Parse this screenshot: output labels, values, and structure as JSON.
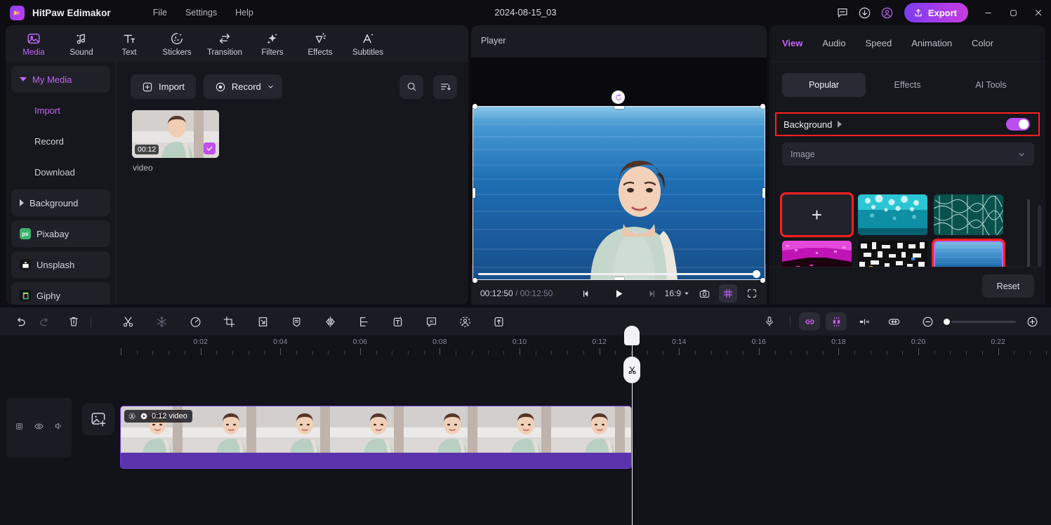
{
  "titlebar": {
    "app_name": "HitPaw Edimakor",
    "menus": [
      {
        "label": "File",
        "name": "menu-file"
      },
      {
        "label": "Settings",
        "name": "menu-settings"
      },
      {
        "label": "Help",
        "name": "menu-help"
      }
    ],
    "project_title": "2024-08-15_03",
    "icons": [
      "feedback-icon",
      "download-icon",
      "account-icon"
    ],
    "export_label": "Export",
    "window_controls": [
      "minimize-icon",
      "maximize-icon",
      "close-icon"
    ]
  },
  "tools": [
    {
      "label": "Media",
      "icon": "media-icon",
      "active": true
    },
    {
      "label": "Sound",
      "icon": "sound-icon",
      "active": false
    },
    {
      "label": "Text",
      "icon": "text-icon",
      "active": false
    },
    {
      "label": "Stickers",
      "icon": "stickers-icon",
      "active": false
    },
    {
      "label": "Transition",
      "icon": "transition-icon",
      "active": false
    },
    {
      "label": "Filters",
      "icon": "filters-icon",
      "active": false
    },
    {
      "label": "Effects",
      "icon": "effects-icon",
      "active": false
    },
    {
      "label": "Subtitles",
      "icon": "subtitles-icon",
      "active": false
    }
  ],
  "sidebar": {
    "my_media": "My Media",
    "sub_items": [
      "Import",
      "Record",
      "Download"
    ],
    "background": "Background",
    "pixabay": "Pixabay",
    "pixabay_badge": "px",
    "unsplash": "Unsplash",
    "giphy": "Giphy"
  },
  "media": {
    "import_label": "Import",
    "record_label": "Record",
    "search_icon": "search-icon",
    "sort_icon": "sort-icon",
    "items": [
      {
        "name": "video",
        "duration": "00:12",
        "selected": true
      }
    ]
  },
  "player": {
    "title": "Player",
    "current_time": "00:12:50",
    "total_time": "00:12:50",
    "separator": "/",
    "aspect_ratio": "16:9",
    "controls": [
      "prev-frame-icon",
      "play-icon",
      "next-frame-icon"
    ],
    "right_icons": [
      "snapshot-icon",
      "grid-icon",
      "fullscreen-icon"
    ]
  },
  "right_panel": {
    "tabs": [
      {
        "label": "View",
        "active": true
      },
      {
        "label": "Audio",
        "active": false
      },
      {
        "label": "Speed",
        "active": false
      },
      {
        "label": "Animation",
        "active": false
      },
      {
        "label": "Color",
        "active": false
      }
    ],
    "segments": [
      {
        "label": "Popular",
        "active": true
      },
      {
        "label": "Effects",
        "active": false
      },
      {
        "label": "AI Tools",
        "active": false
      }
    ],
    "background_label": "Background",
    "background_enabled": true,
    "source_select": "Image",
    "add_label": "+",
    "reset_label": "Reset",
    "highlight_color": "#ff1f1f",
    "accent_color": "#c265f5",
    "thumbs": [
      {
        "name": "add-background-tile",
        "kind": "add",
        "highlighted": true
      },
      {
        "name": "background-tile-teal-splash",
        "kind": "image",
        "c1": "#17b4c4",
        "c2": "#0a7f92"
      },
      {
        "name": "background-tile-dark-teal-veins",
        "kind": "image",
        "c1": "#0d6a63",
        "c2": "#04403e"
      },
      {
        "name": "background-tile-magenta-tunnel",
        "kind": "image",
        "c1": "#d816c9",
        "c2": "#2a0318"
      },
      {
        "name": "background-tile-monochrome-noise",
        "kind": "image",
        "c1": "#dedede",
        "c2": "#151515"
      },
      {
        "name": "background-tile-blue-ocean",
        "kind": "image",
        "c1": "#5fb0dd",
        "c2": "#17538e",
        "selected": true
      }
    ]
  },
  "timeline_toolbar": {
    "left_icons": [
      "undo-icon",
      "redo-icon",
      "delete-icon",
      "divider",
      "split-icon",
      "freeze-frame-icon",
      "speed-icon",
      "crop-icon",
      "export-frame-icon",
      "marker-icon",
      "mirror-icon",
      "align-icon",
      "add-text-icon",
      "ai-caption-icon",
      "portrait-cutout-icon",
      "upload-icon"
    ],
    "right_icons": [
      "microphone-icon",
      "divider",
      "link-icon",
      "magnet-icon",
      "split-view-icon",
      "fit-timeline-icon",
      "zoom-out-icon",
      "zoom-slider",
      "zoom-in-icon"
    ]
  },
  "timeline": {
    "ruler_labels": [
      "0:02",
      "0:04",
      "0:06",
      "0:08",
      "0:10",
      "0:12",
      "0:14",
      "0:16",
      "0:18",
      "0:20",
      "0:22"
    ],
    "track_head_icons": [
      "lock-icon",
      "eye-icon",
      "mute-icon"
    ],
    "add_track_icon": "add-media-icon",
    "clip": {
      "label": "0:12 video",
      "duration": "0:12",
      "name": "video",
      "badge_icons": [
        "cutout-icon",
        "video-type-icon"
      ],
      "audio_color": "#5b33ac"
    },
    "playhead_time": "0:12:50"
  }
}
